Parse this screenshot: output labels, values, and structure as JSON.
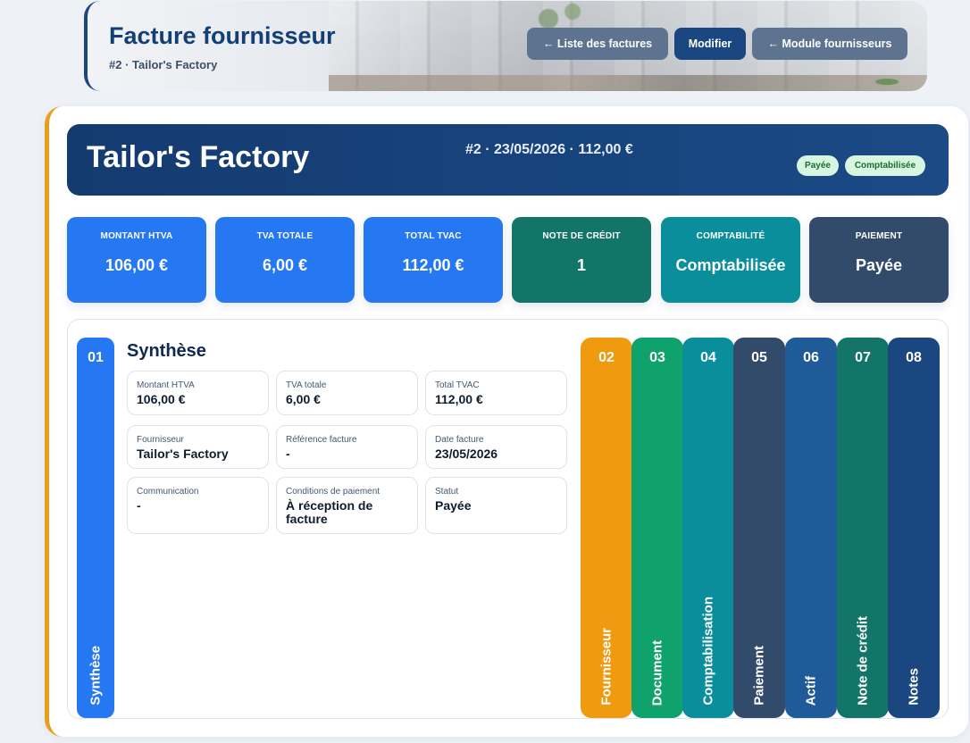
{
  "header": {
    "title": "Facture fournisseur",
    "subtitle": "#2 · Tailor's Factory",
    "buttons": {
      "list": "← Liste des factures",
      "edit": "Modifier",
      "module": "← Module fournisseurs"
    }
  },
  "hero": {
    "supplier": "Tailor's Factory",
    "meta": "#2 · 23/05/2026 · 112,00 €",
    "badges": [
      "Payée",
      "Comptabilisée"
    ]
  },
  "kpis": [
    {
      "label": "MONTANT HTVA",
      "value": "106,00 €"
    },
    {
      "label": "TVA TOTALE",
      "value": "6,00 €"
    },
    {
      "label": "TOTAL TVAC",
      "value": "112,00 €"
    },
    {
      "label": "NOTE DE CRÉDIT",
      "value": "1"
    },
    {
      "label": "COMPTABILITÉ",
      "value": "Comptabilisée"
    },
    {
      "label": "PAIEMENT",
      "value": "Payée"
    }
  ],
  "active_tab": {
    "num": "01",
    "label": "Synthèse"
  },
  "summary": {
    "title": "Synthèse",
    "fields": [
      {
        "label": "Montant HTVA",
        "value": "106,00 €"
      },
      {
        "label": "TVA totale",
        "value": "6,00 €"
      },
      {
        "label": "Total TVAC",
        "value": "112,00 €"
      },
      {
        "label": "Fournisseur",
        "value": "Tailor's Factory"
      },
      {
        "label": "Référence facture",
        "value": "-"
      },
      {
        "label": "Date facture",
        "value": "23/05/2026"
      },
      {
        "label": "Communication",
        "value": "-"
      },
      {
        "label": "Conditions de paiement",
        "value": "À réception de facture"
      },
      {
        "label": "Statut",
        "value": "Payée"
      }
    ]
  },
  "tabs": [
    {
      "num": "02",
      "label": "Fournisseur"
    },
    {
      "num": "03",
      "label": "Document"
    },
    {
      "num": "04",
      "label": "Comptabilisation"
    },
    {
      "num": "05",
      "label": "Paiement"
    },
    {
      "num": "06",
      "label": "Actif"
    },
    {
      "num": "07",
      "label": "Note de crédit"
    },
    {
      "num": "08",
      "label": "Notes"
    }
  ],
  "colors": {
    "accent_blue": "#2677f2",
    "navy": "#1a4780",
    "orange": "#f09a10",
    "green": "#0fa26d",
    "teal": "#0a8e9c",
    "slate": "#334b6b"
  }
}
